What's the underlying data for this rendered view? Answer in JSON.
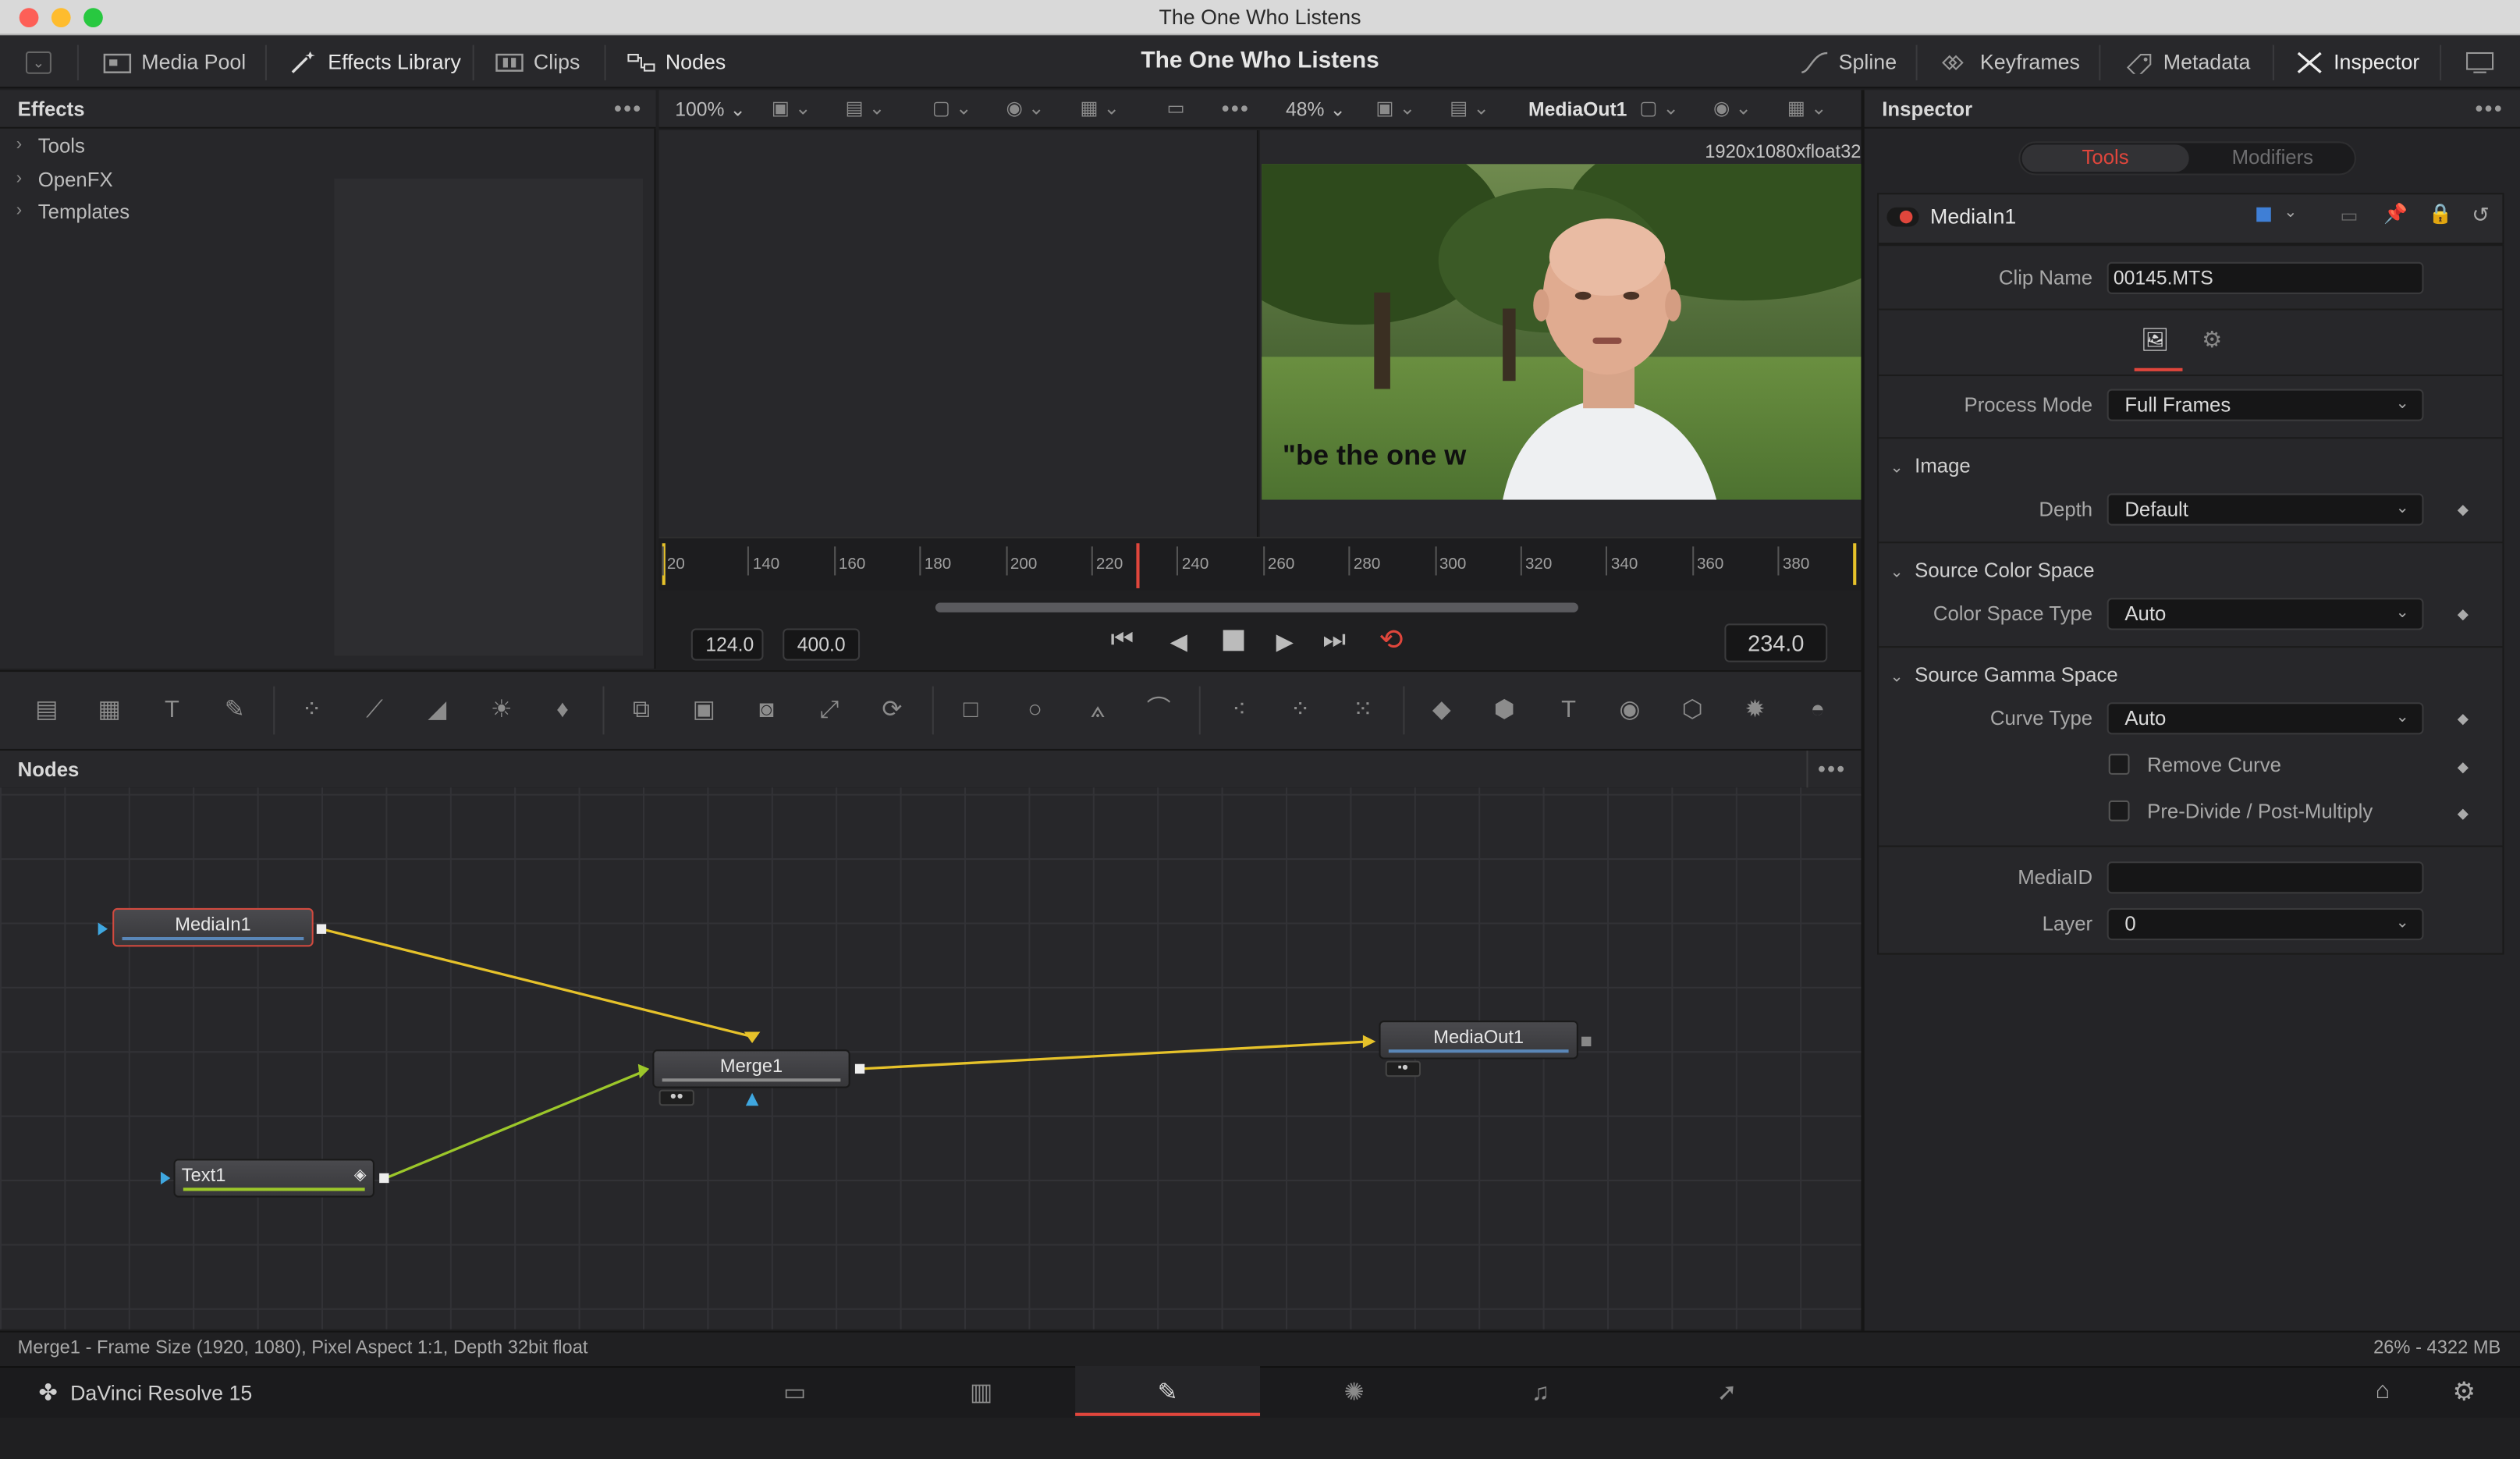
{
  "window": {
    "title": "The One Who Listens"
  },
  "topbar": {
    "media_pool": "Media Pool",
    "effects_library": "Effects Library",
    "clips": "Clips",
    "nodes": "Nodes",
    "project_title": "The One Who Listens",
    "spline": "Spline",
    "keyframes": "Keyframes",
    "metadata": "Metadata",
    "inspector": "Inspector"
  },
  "effects": {
    "header": "Effects",
    "items": [
      "Tools",
      "OpenFX",
      "Templates"
    ]
  },
  "viewer": {
    "left_zoom": "100%",
    "right_zoom": "48%",
    "output_name": "MediaOut1",
    "resolution": "1920x1080xfloat32",
    "overlay_text": "\"be the one w",
    "ruler_ticks": [
      "20",
      "140",
      "160",
      "180",
      "200",
      "220",
      "240",
      "260",
      "280",
      "300",
      "320",
      "340",
      "360",
      "380"
    ],
    "range_start": "124.0",
    "range_end": "400.0",
    "current_frame": "234.0"
  },
  "nodes": {
    "header": "Nodes",
    "media_in": "MediaIn1",
    "merge": "Merge1",
    "media_out": "MediaOut1",
    "text": "Text1"
  },
  "inspector": {
    "header": "Inspector",
    "tab_tools": "Tools",
    "tab_modifiers": "Modifiers",
    "node_name": "MediaIn1",
    "clip_name_label": "Clip Name",
    "clip_name_value": "00145.MTS",
    "process_mode_label": "Process Mode",
    "process_mode_value": "Full Frames",
    "image_section": "Image",
    "depth_label": "Depth",
    "depth_value": "Default",
    "source_color_section": "Source Color Space",
    "color_space_type_label": "Color Space Type",
    "color_space_type_value": "Auto",
    "source_gamma_section": "Source Gamma Space",
    "curve_type_label": "Curve Type",
    "curve_type_value": "Auto",
    "remove_curve": "Remove Curve",
    "predivide": "Pre-Divide / Post-Multiply",
    "mediaid_label": "MediaID",
    "mediaid_value": "",
    "layer_label": "Layer",
    "layer_value": "0"
  },
  "status": {
    "left": "Merge1 - Frame Size (1920, 1080), Pixel Aspect 1:1, Depth 32bit float",
    "right": "26% - 4322 MB"
  },
  "bottom": {
    "app_name": "DaVinci Resolve 15"
  },
  "colors": {
    "accent_red": "#e0463c",
    "node_line_yellow": "#e6c22a",
    "node_line_green": "#9cc72a",
    "media_in_border": "#d14a3f"
  }
}
